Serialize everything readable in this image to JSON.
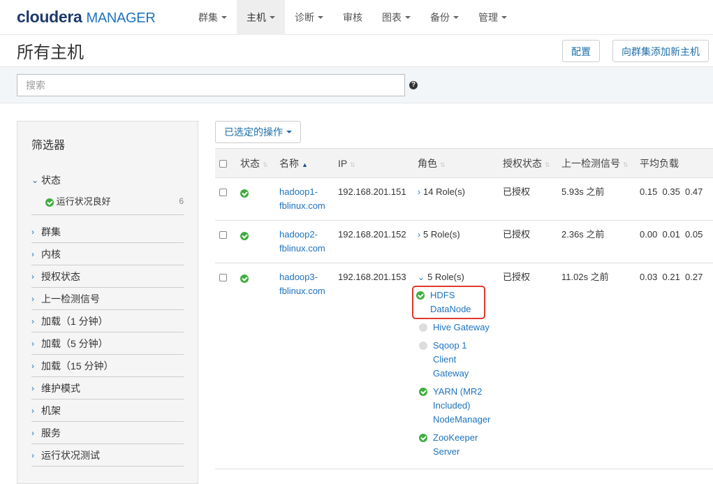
{
  "brand": {
    "name": "cloudera",
    "product": "MANAGER"
  },
  "nav": {
    "items": [
      {
        "label": "群集",
        "dropdown": true,
        "active": false
      },
      {
        "label": "主机",
        "dropdown": true,
        "active": true
      },
      {
        "label": "诊断",
        "dropdown": true,
        "active": false
      },
      {
        "label": "审核",
        "dropdown": false,
        "active": false
      },
      {
        "label": "图表",
        "dropdown": true,
        "active": false
      },
      {
        "label": "备份",
        "dropdown": true,
        "active": false
      },
      {
        "label": "管理",
        "dropdown": true,
        "active": false
      }
    ]
  },
  "header": {
    "title": "所有主机",
    "config_label": "配置",
    "add_host_label": "向群集添加新主机"
  },
  "search": {
    "placeholder": "搜索",
    "value": "",
    "help_icon": "question-circle-icon"
  },
  "filters": {
    "title": "筛选器",
    "state_group": {
      "label": "状态",
      "sub": {
        "label": "运行状况良好",
        "count": "6"
      }
    },
    "groups": [
      "群集",
      "内核",
      "授权状态",
      "上一检测信号",
      "加载（1 分钟）",
      "加载（5 分钟）",
      "加载（15 分钟）",
      "维护模式",
      "机架",
      "服务",
      "运行状况测试"
    ]
  },
  "actions": {
    "label": "已选定的操作"
  },
  "table": {
    "columns": [
      "状态",
      "名称",
      "IP",
      "角色",
      "授权状态",
      "上一检测信号",
      "平均负载"
    ],
    "rows": [
      {
        "name": "hadoop1-fblinux.com",
        "name_l1": "hadoop1-",
        "name_l2": "fblinux.com",
        "ip": "192.168.201.151",
        "roles": "14 Role(s)",
        "expanded": false,
        "license": "已授权",
        "heartbeat": "5.93s 之前",
        "load": "0.15  0.35  0.47"
      },
      {
        "name": "hadoop2-fblinux.com",
        "name_l1": "hadoop2-",
        "name_l2": "fblinux.com",
        "ip": "192.168.201.152",
        "roles": "5 Role(s)",
        "expanded": false,
        "license": "已授权",
        "heartbeat": "2.36s 之前",
        "load": "0.00  0.01  0.05"
      },
      {
        "name": "hadoop3-fblinux.com",
        "name_l1": "hadoop3-",
        "name_l2": "fblinux.com",
        "ip": "192.168.201.153",
        "roles": "5 Role(s)",
        "expanded": true,
        "license": "已授权",
        "heartbeat": "11.02s 之前",
        "load": "0.03  0.21  0.27",
        "role_list": [
          {
            "lines": [
              "HDFS",
              "DataNode"
            ],
            "status": "good",
            "highlighted": true
          },
          {
            "lines": [
              "Hive Gateway"
            ],
            "status": "none",
            "highlighted": false
          },
          {
            "lines": [
              "Sqoop 1",
              "Client",
              "Gateway"
            ],
            "status": "none",
            "highlighted": false
          },
          {
            "lines": [
              "YARN (MR2",
              "Included)",
              "NodeManager"
            ],
            "status": "good",
            "highlighted": false
          },
          {
            "lines": [
              "ZooKeeper",
              "Server"
            ],
            "status": "good",
            "highlighted": false
          }
        ]
      }
    ]
  },
  "colors": {
    "accent": "#1e73be",
    "good": "#3fae3f",
    "highlight": "#e0392f"
  }
}
